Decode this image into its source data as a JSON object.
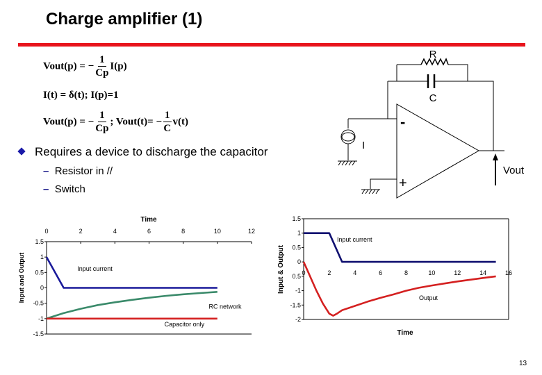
{
  "slide": {
    "title": "Charge amplifier (1)",
    "accent_color": "#e8141c",
    "page_number": "13"
  },
  "equations": {
    "eq1": {
      "lhs": "Vout(p) = −",
      "num": "1",
      "den": "Cp",
      "rhs": "I(p)"
    },
    "eq2": {
      "text": "I(t) = δ(t); I(p)=1"
    },
    "eq3": {
      "lhs": "Vout(p) = −",
      "num": "1",
      "den": "Cp",
      "mid": "; Vout(t)= −",
      "num2": "1",
      "den2": "C",
      "rhs": "v(t)"
    }
  },
  "bullets": {
    "main": "Requires a device to discharge the capacitor",
    "subs": [
      "Resistor in //",
      "Switch"
    ],
    "dash": "–"
  },
  "circuit": {
    "resistor_label": "R",
    "capacitor_label": "C",
    "source_label": "I",
    "minus_label": "-",
    "plus_label": "+",
    "output_label": "Vout"
  },
  "chart_data": [
    {
      "type": "line",
      "title": "",
      "xlabel": "Time",
      "ylabel": "Input and Output",
      "xlim": [
        0,
        12
      ],
      "ylim": [
        -1.5,
        1.5
      ],
      "x_ticks": [
        "0",
        "2",
        "4",
        "6",
        "8",
        "10",
        "12"
      ],
      "y_ticks": [
        "1.5",
        "1",
        "0.5",
        "0",
        "-0.5",
        "-1",
        "-1.5"
      ],
      "x_axis_position": "top",
      "grid": false,
      "series": [
        {
          "name": "Input current",
          "color": "#1a1a9a",
          "x": [
            0,
            1,
            10
          ],
          "y": [
            1,
            0,
            0
          ],
          "label_at": [
            1.8,
            0.55
          ]
        },
        {
          "name": "RC network",
          "color": "#3a8a6a",
          "x": [
            0,
            1,
            2,
            3,
            4,
            5,
            6,
            7,
            8,
            9,
            10
          ],
          "y": [
            -1,
            -0.82,
            -0.68,
            -0.56,
            -0.47,
            -0.39,
            -0.32,
            -0.26,
            -0.21,
            -0.17,
            -0.13
          ],
          "label_at": [
            9.5,
            -0.68
          ]
        },
        {
          "name": "Capacitor only",
          "color": "#d42020",
          "x": [
            0,
            10
          ],
          "y": [
            -1,
            -1
          ],
          "label_at": [
            6.9,
            -1.25
          ]
        }
      ]
    },
    {
      "type": "line",
      "title": "",
      "xlabel": "Time",
      "ylabel": "Input & Output",
      "xlim": [
        0,
        16
      ],
      "ylim": [
        -2,
        1.5
      ],
      "x_ticks": [
        "0",
        "2",
        "4",
        "6",
        "8",
        "10",
        "12",
        "14",
        "16"
      ],
      "y_ticks": [
        "1.5",
        "1",
        "0.5",
        "0",
        "0.5",
        "-1",
        "-1.5",
        "-2"
      ],
      "grid": false,
      "series": [
        {
          "name": "Input current",
          "color": "#101070",
          "x": [
            0,
            2,
            3,
            15
          ],
          "y": [
            1,
            1,
            0,
            0
          ],
          "label_at": [
            2.6,
            0.7
          ]
        },
        {
          "name": "Output",
          "color": "#d42020",
          "x": [
            0,
            0.5,
            1,
            1.5,
            2,
            2.3,
            2.6,
            3,
            4,
            5,
            6,
            7,
            8,
            9,
            10,
            11,
            12,
            13,
            14,
            15
          ],
          "y": [
            0,
            -0.5,
            -1.0,
            -1.45,
            -1.8,
            -1.87,
            -1.8,
            -1.68,
            -1.53,
            -1.38,
            -1.25,
            -1.13,
            -1.0,
            -0.9,
            -0.82,
            -0.75,
            -0.68,
            -0.62,
            -0.56,
            -0.5
          ],
          "label_at": [
            9,
            -1.32
          ]
        }
      ]
    }
  ]
}
